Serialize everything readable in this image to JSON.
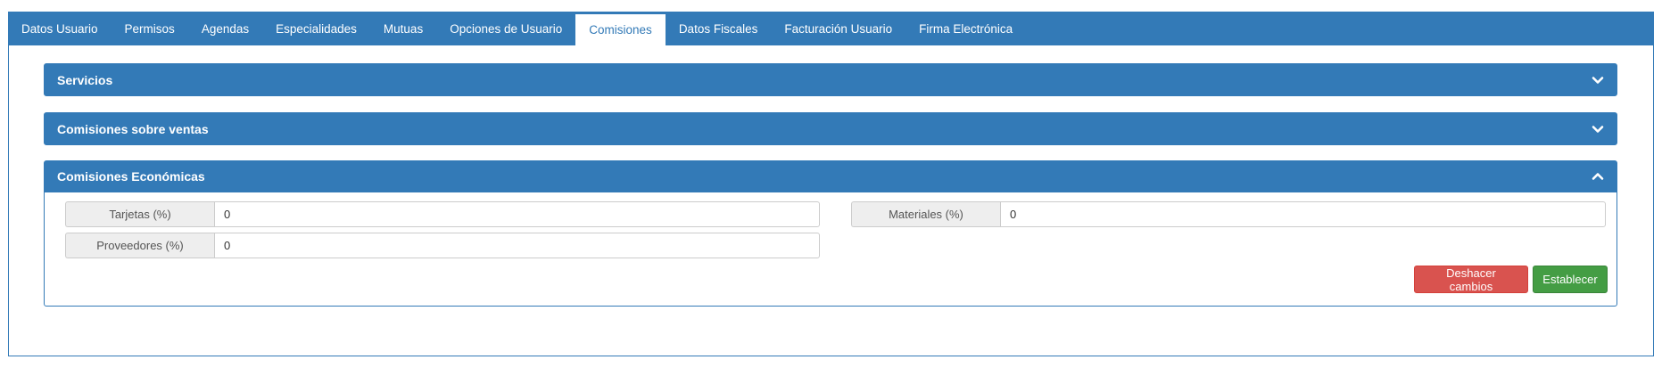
{
  "tabs": [
    {
      "label": "Datos Usuario",
      "active": false
    },
    {
      "label": "Permisos",
      "active": false
    },
    {
      "label": "Agendas",
      "active": false
    },
    {
      "label": "Especialidades",
      "active": false
    },
    {
      "label": "Mutuas",
      "active": false
    },
    {
      "label": "Opciones de Usuario",
      "active": false
    },
    {
      "label": "Comisiones",
      "active": true
    },
    {
      "label": "Datos Fiscales",
      "active": false
    },
    {
      "label": "Facturación Usuario",
      "active": false
    },
    {
      "label": "Firma Electrónica",
      "active": false
    }
  ],
  "panels": {
    "servicios": {
      "title": "Servicios",
      "state": "collapsed",
      "icon": "chevron-down-icon"
    },
    "ventas": {
      "title": "Comisiones sobre ventas",
      "state": "collapsed",
      "icon": "chevron-down-icon"
    },
    "economicas": {
      "title": "Comisiones Económicas",
      "state": "expanded",
      "icon": "chevron-up-icon",
      "fields": {
        "tarjetas": {
          "label": "Tarjetas (%)",
          "value": "0"
        },
        "proveedores": {
          "label": "Proveedores (%)",
          "value": "0"
        },
        "materiales": {
          "label": "Materiales (%)",
          "value": "0"
        }
      },
      "buttons": {
        "undo": "Deshacer cambios",
        "set": "Establecer"
      }
    }
  },
  "colors": {
    "primary": "#337ab7",
    "danger": "#d9534f",
    "success": "#449d44"
  }
}
